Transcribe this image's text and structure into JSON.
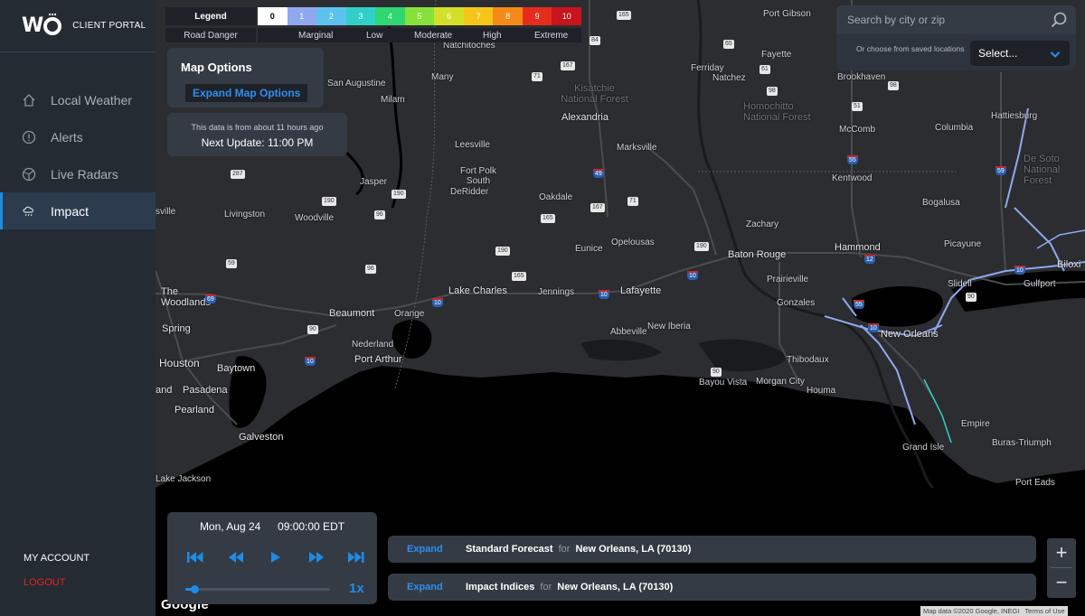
{
  "brand": {
    "logo": "W",
    "title": "CLIENT PORTAL"
  },
  "nav": [
    {
      "label": "Local Weather",
      "icon": "home-icon"
    },
    {
      "label": "Alerts",
      "icon": "alert-icon"
    },
    {
      "label": "Live Radars",
      "icon": "radar-icon"
    },
    {
      "label": "Impact",
      "icon": "cloud-rain-icon",
      "active": true
    }
  ],
  "account": {
    "my_account": "MY ACCOUNT",
    "logout": "LOGOUT"
  },
  "legend": {
    "title": "Legend",
    "scale": [
      {
        "value": "0",
        "color": "#ffffff",
        "text": "#000000"
      },
      {
        "value": "1",
        "color": "#8fa8f0",
        "text": "#ffffff"
      },
      {
        "value": "2",
        "color": "#5cc2f0",
        "text": "#ffffff"
      },
      {
        "value": "3",
        "color": "#30d0c8",
        "text": "#ffffff"
      },
      {
        "value": "4",
        "color": "#2fd870",
        "text": "#ffffff"
      },
      {
        "value": "5",
        "color": "#86e23a",
        "text": "#ffffff"
      },
      {
        "value": "6",
        "color": "#d4e028",
        "text": "#ffffff"
      },
      {
        "value": "7",
        "color": "#f6c51a",
        "text": "#ffffff"
      },
      {
        "value": "8",
        "color": "#f58a1a",
        "text": "#ffffff"
      },
      {
        "value": "9",
        "color": "#e82c1c",
        "text": "#ffffff"
      },
      {
        "value": "10",
        "color": "#c8141c",
        "text": "#ffffff"
      }
    ],
    "captions": [
      "Road Danger",
      "Marginal",
      "Low",
      "Moderate",
      "High",
      "Extreme"
    ]
  },
  "map_options": {
    "title": "Map Options",
    "expand_label": "Expand Map Options"
  },
  "update": {
    "age_text": "This data is from about 11 hours ago",
    "next_update": "Next Update: 11:00 PM"
  },
  "search": {
    "placeholder": "Search by city or zip",
    "saved_hint": "Or choose from saved locations",
    "select_label": "Select..."
  },
  "player": {
    "date": "Mon, Aug 24",
    "time": "09:00:00 EDT",
    "speed": "1x",
    "progress": 0.06
  },
  "forecast_bars": [
    {
      "expand": "Expand",
      "name": "Standard Forecast",
      "for": "for",
      "location": "New Orleans, LA (70130)"
    },
    {
      "expand": "Expand",
      "name": "Impact Indices",
      "for": "for",
      "location": "New Orleans, LA (70130)"
    }
  ],
  "zoom": {
    "in": "+",
    "out": "−"
  },
  "map": {
    "cities": [
      "Port Gibson",
      "Fayette",
      "Natchez",
      "Ferriday",
      "Brookhaven",
      "Hattiesburg",
      "Columbia",
      "De Soto National Forest",
      "Homochitto National Forest",
      "McComb",
      "Kentwood",
      "Bogalusa",
      "Picayune",
      "Hammond",
      "Zachary",
      "Baton Rouge",
      "Slidell",
      "Biloxi",
      "Gulfport",
      "Prairieville",
      "Gonzales",
      "New Orleans",
      "Thibodaux",
      "Houma",
      "Morgan City",
      "Bayou Vista",
      "Empire",
      "Grand Isle",
      "Buras-Triumph",
      "Port Eads",
      "Natchitoches",
      "Kisatchie National Forest",
      "Alexandria",
      "Marksville",
      "Many",
      "San Augustine",
      "Milam",
      "Leesville",
      "Fort Polk South",
      "DeRidder",
      "Oakdale",
      "Opelousas",
      "Eunice",
      "Lafayette",
      "Jennings",
      "Lake Charles",
      "New Iberia",
      "Abbeville",
      "Jasper",
      "Livingston",
      "Woodville",
      "The Woodlands",
      "Spring",
      "Houston",
      "Baytown",
      "Pasadena",
      "Pearland",
      "Galveston",
      "Beaumont",
      "Orange",
      "Nederland",
      "Port Arthur",
      "Lake Jackson",
      "sville",
      "and"
    ],
    "attribution": [
      "Map data ©2020 Google, INEGI",
      "Terms of Use"
    ],
    "provider": "Google"
  }
}
